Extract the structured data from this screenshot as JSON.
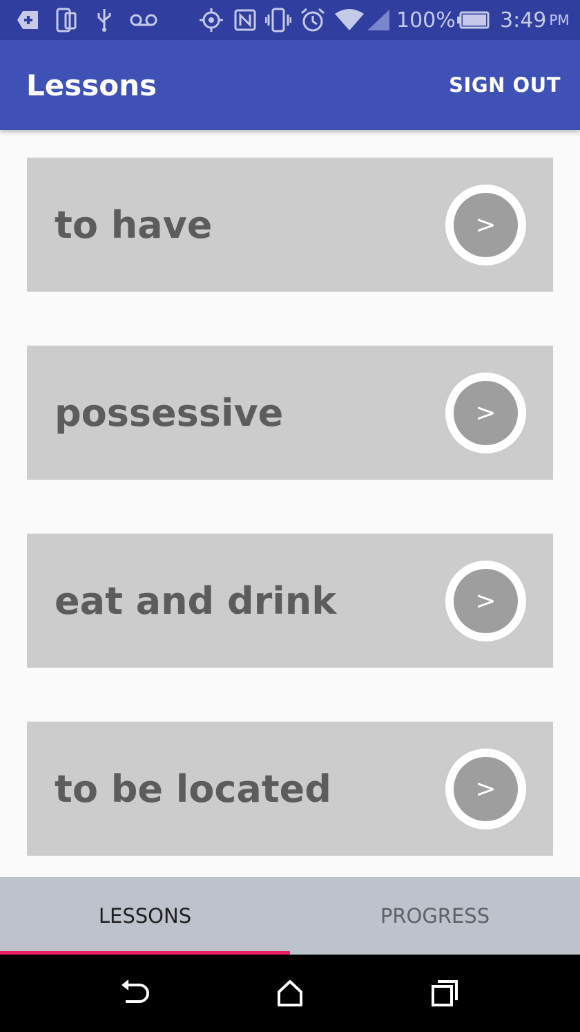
{
  "status_bar": {
    "battery": "100%",
    "time": "3:49",
    "ampm": "PM",
    "icons": [
      "sd-card-icon",
      "phone-icon",
      "usb-icon",
      "voicemail-icon",
      "gps-icon",
      "nfc-icon",
      "vibrate-icon",
      "alarm-icon",
      "wifi-icon",
      "signal-icon",
      "battery-icon"
    ]
  },
  "app_bar": {
    "title": "Lessons",
    "sign_out_label": "SIGN OUT"
  },
  "lessons": [
    {
      "label": "to have",
      "button": ">"
    },
    {
      "label": "possessive",
      "button": ">"
    },
    {
      "label": "eat and drink",
      "button": ">"
    },
    {
      "label": "to be located",
      "button": ">"
    }
  ],
  "tabs": [
    {
      "label": "LESSONS",
      "active": true
    },
    {
      "label": "PROGRESS",
      "active": false
    }
  ],
  "colors": {
    "status_bar": "#303f9f",
    "app_bar": "#3f51b5",
    "card": "#cccccc",
    "tab_indicator": "#e91e63",
    "tab_bar": "#bec2cb"
  },
  "nav_bar": {
    "icons": [
      "back-icon",
      "home-icon",
      "recents-icon"
    ]
  }
}
